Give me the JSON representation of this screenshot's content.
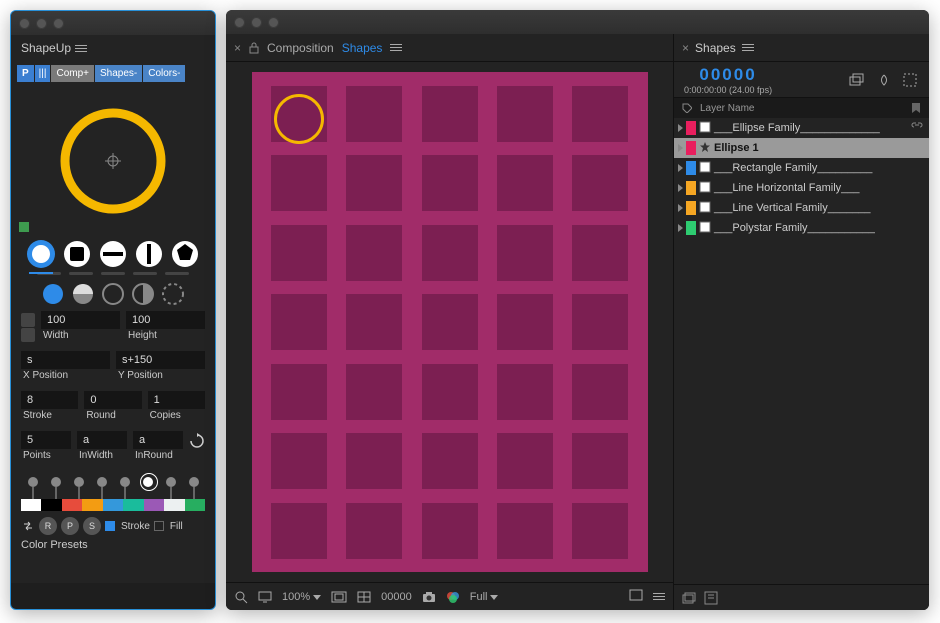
{
  "shapeup": {
    "title": "ShapeUp",
    "tags": {
      "p": "P",
      "bars": "|||",
      "comp": "Comp+",
      "shapes": "Shapes-",
      "colors": "Colors-"
    },
    "width": {
      "value": "100",
      "label": "Width"
    },
    "height": {
      "value": "100",
      "label": "Height"
    },
    "xpos": {
      "value": "s",
      "label": "X Position"
    },
    "ypos": {
      "value": "s+150",
      "label": "Y Position"
    },
    "stroke": {
      "value": "8",
      "label": "Stroke"
    },
    "round": {
      "value": "0",
      "label": "Round"
    },
    "copies": {
      "value": "1",
      "label": "Copies"
    },
    "points": {
      "value": "5",
      "label": "Points"
    },
    "inwidth": {
      "value": "a",
      "label": "InWidth"
    },
    "inround": {
      "value": "a",
      "label": "InRound"
    },
    "swatches": [
      "#fff",
      "#000",
      "#e74c3c",
      "#f39c12",
      "#3498db",
      "#1abc9c",
      "#9b59b6",
      "#ecf0f1",
      "#27ae60"
    ],
    "preset_buttons": [
      "R",
      "P",
      "S"
    ],
    "stroke_label": "Stroke",
    "fill_label": "Fill",
    "footer": "Color Presets"
  },
  "comp": {
    "tab_prefix": "Composition",
    "tab_name": "Shapes",
    "footer": {
      "zoom": "100%",
      "ratio": "",
      "frame": "00000",
      "quality": "Full"
    }
  },
  "layers": {
    "tab": "Shapes",
    "timecode": "00000",
    "timecode_sub": "0:00:00:00 (24.00 fps)",
    "header": "Layer Name",
    "rows": [
      {
        "color": "#e81f5e",
        "name": "___Ellipse Family_____________"
      },
      {
        "color": "#e81f5e",
        "name": "Ellipse 1",
        "selected": true,
        "star": true
      },
      {
        "color": "#2e8be8",
        "name": "___Rectangle Family_________"
      },
      {
        "color": "#f5a623",
        "name": "___Line Horizontal Family___"
      },
      {
        "color": "#f5a623",
        "name": "___Line Vertical Family_______"
      },
      {
        "color": "#2ecc71",
        "name": "___Polystar Family___________"
      }
    ]
  }
}
